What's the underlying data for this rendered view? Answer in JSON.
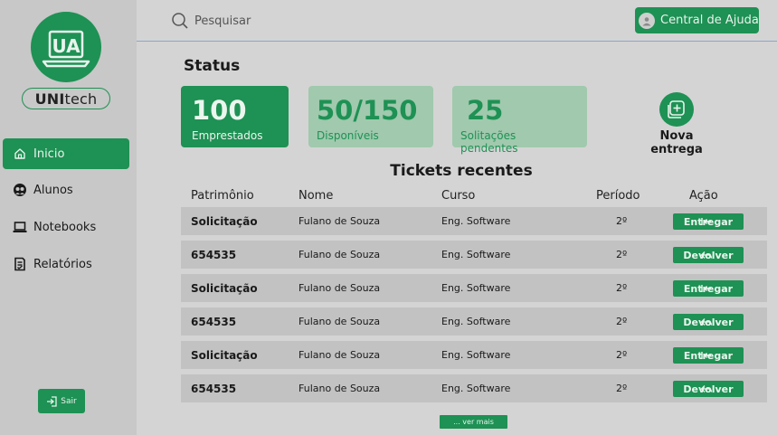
{
  "brand": {
    "logo_text": "UA",
    "name_bold": "UNI",
    "name_rest": "tech"
  },
  "colors": {
    "accent": "#1e9154",
    "accent_light": "#a0c9ad",
    "background": "#d4d4d4",
    "sidebar": "#c8c8c8"
  },
  "sidebar": {
    "items": [
      {
        "label": "Inicio",
        "icon": "home-icon",
        "active": true
      },
      {
        "label": "Alunos",
        "icon": "users-icon",
        "active": false
      },
      {
        "label": "Notebooks",
        "icon": "laptop-icon",
        "active": false
      },
      {
        "label": "Relatórios",
        "icon": "report-icon",
        "active": false
      }
    ],
    "logout_label": "Sair"
  },
  "header": {
    "search_placeholder": "Pesquisar",
    "help_label": "Central de Ajuda"
  },
  "status": {
    "title": "Status",
    "cards": [
      {
        "value": "100",
        "label": "Emprestados"
      },
      {
        "value": "50/150",
        "label": "Disponíveis"
      },
      {
        "value": "25",
        "label": "Solitações pendentes"
      }
    ],
    "new_delivery_label": "Nova entrega"
  },
  "tickets": {
    "title": "Tickets recentes",
    "columns": [
      "Patrimônio",
      "Nome",
      "Curso",
      "Período",
      "Ação"
    ],
    "rows": [
      {
        "patrimonio": "Solicitação",
        "nome": "Fulano de Souza",
        "curso": "Eng. Software",
        "periodo": "2º",
        "acao": "Entregar"
      },
      {
        "patrimonio": "654535",
        "nome": "Fulano de Souza",
        "curso": "Eng. Software",
        "periodo": "2º",
        "acao": "Devolver"
      },
      {
        "patrimonio": "Solicitação",
        "nome": "Fulano de Souza",
        "curso": "Eng. Software",
        "periodo": "2º",
        "acao": "Entregar"
      },
      {
        "patrimonio": "654535",
        "nome": "Fulano de Souza",
        "curso": "Eng. Software",
        "periodo": "2º",
        "acao": "Devolver"
      },
      {
        "patrimonio": "Solicitação",
        "nome": "Fulano de Souza",
        "curso": "Eng. Software",
        "periodo": "2º",
        "acao": "Entregar"
      },
      {
        "patrimonio": "654535",
        "nome": "Fulano de Souza",
        "curso": "Eng. Software",
        "periodo": "2º",
        "acao": "Devolver"
      }
    ],
    "more_label": "... ver mais"
  }
}
